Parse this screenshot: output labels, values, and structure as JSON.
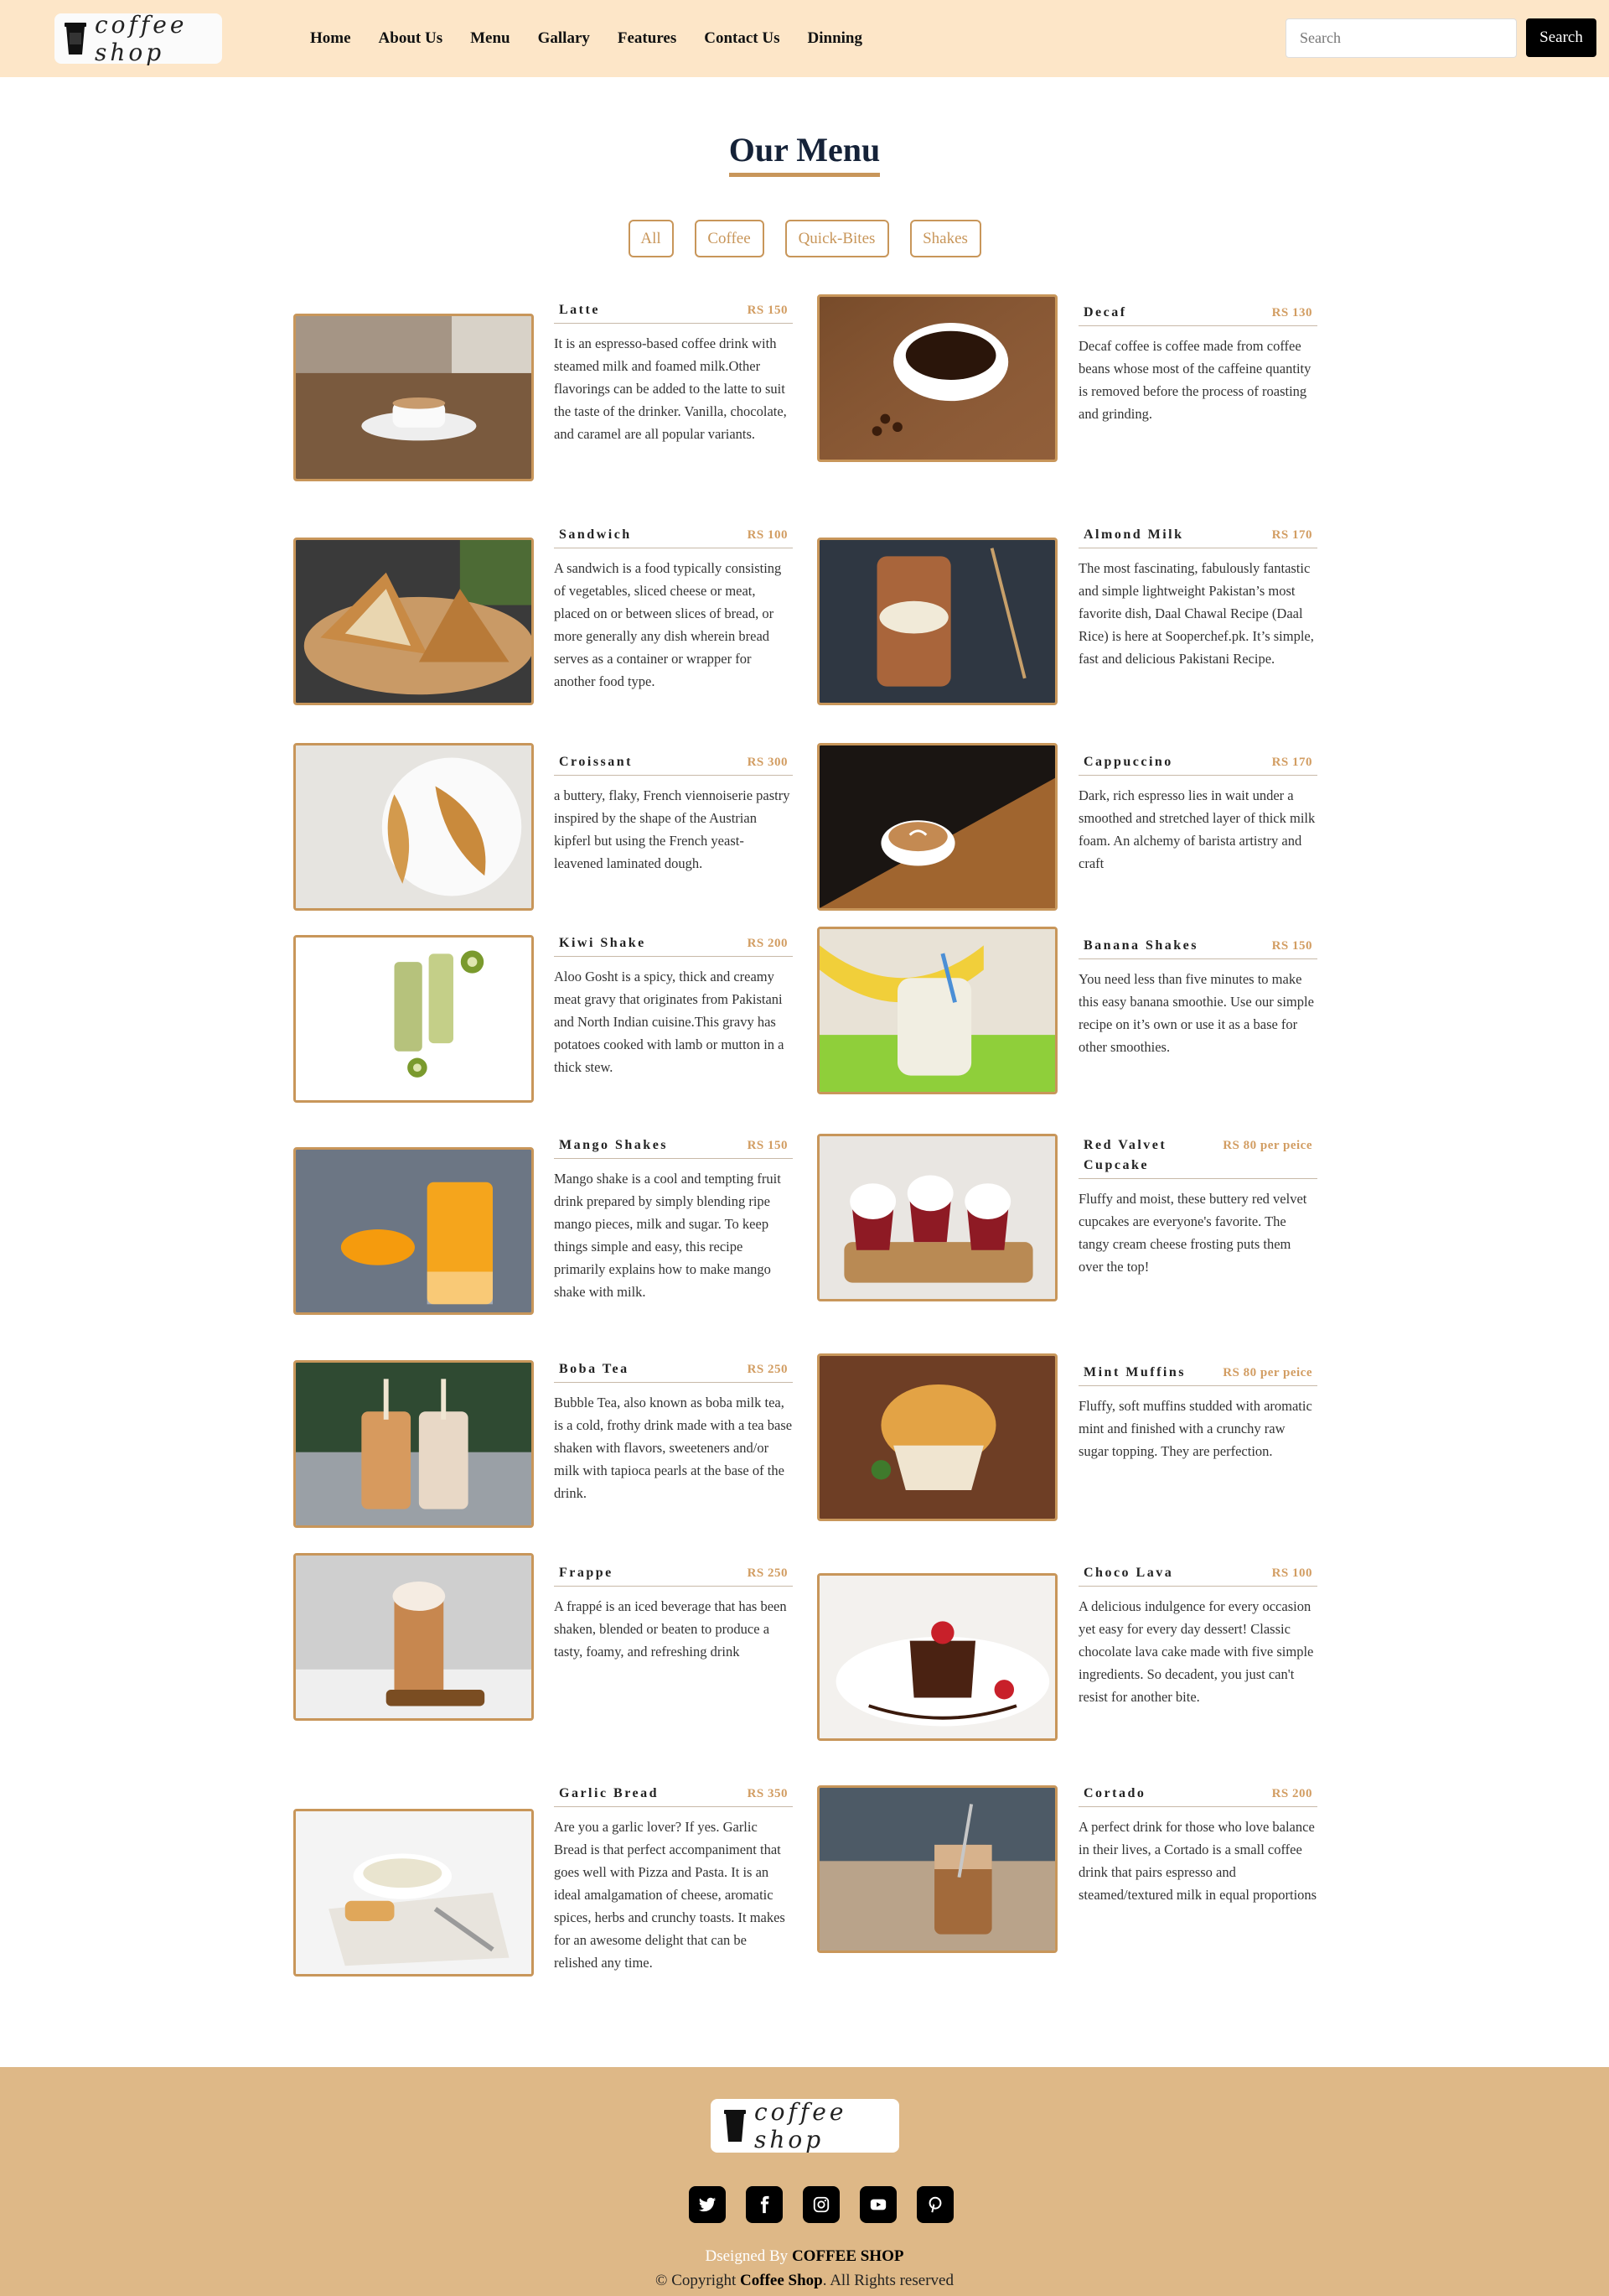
{
  "nav": {
    "logo_text": "coffee shop",
    "links": [
      "Home",
      "About Us",
      "Menu",
      "Gallary",
      "Features",
      "Contact Us",
      "Dinning"
    ],
    "search_placeholder": "Search",
    "search_button": "Search"
  },
  "menu": {
    "title": "Our Menu",
    "filters": [
      "All",
      "Coffee",
      "Quick-Bites",
      "Shakes"
    ],
    "items": [
      {
        "name": "Latte",
        "price": "RS 150",
        "desc": "It is an espresso-based coffee drink with steamed milk and foamed milk.Other flavorings can be added to the latte to suit the taste of the drinker. Vanilla, chocolate, and caramel are all popular variants.",
        "image": "latte-photo"
      },
      {
        "name": "Decaf",
        "price": "RS 130",
        "desc": "Decaf coffee is coffee made from coffee beans whose most of the caffeine quantity is removed before the process of roasting and grinding.",
        "image": "decaf-photo"
      },
      {
        "name": "Sandwich",
        "price": "RS 100",
        "desc": "A sandwich is a food typically consisting of vegetables, sliced cheese or meat, placed on or between slices of bread, or more generally any dish wherein bread serves as a container or wrapper for another food type.",
        "image": "sandwich-photo"
      },
      {
        "name": "Almond Milk",
        "price": "RS 170",
        "desc": "The most fascinating, fabulously fantastic and simple lightweight Pakistan’s most favorite dish, Daal Chawal Recipe (Daal Rice) is here at Sooperchef.pk. It’s simple, fast and delicious Pakistani Recipe.",
        "image": "almond-milk-photo"
      },
      {
        "name": "Croissant",
        "price": "RS 300",
        "desc": "a buttery, flaky, French viennoiserie pastry inspired by the shape of the Austrian kipferl but using the French yeast-leavened laminated dough.",
        "image": "croissant-photo"
      },
      {
        "name": "Cappuccino",
        "price": "RS 170",
        "desc": "Dark, rich espresso lies in wait under a smoothed and stretched layer of thick milk foam. An alchemy of barista artistry and craft",
        "image": "cappuccino-photo"
      },
      {
        "name": "Kiwi Shake",
        "price": "RS 200",
        "desc": "Aloo Gosht is a spicy, thick and creamy meat gravy that originates from Pakistani and North Indian cuisine.This gravy has potatoes cooked with lamb or mutton in a thick stew.",
        "image": "kiwi-shake-photo"
      },
      {
        "name": "Banana Shakes",
        "price": "RS 150",
        "desc": "You need less than five minutes to make this easy banana smoothie. Use our simple recipe on it’s own or use it as a base for other smoothies.",
        "image": "banana-shake-photo"
      },
      {
        "name": "Mango Shakes",
        "price": "RS 150",
        "desc": "Mango shake is a cool and tempting fruit drink prepared by simply blending ripe mango pieces, milk and sugar. To keep things simple and easy, this recipe primarily explains how to make mango shake with milk.",
        "image": "mango-shake-photo"
      },
      {
        "name": "Red Valvet Cupcake",
        "price": "RS 80 per peice",
        "desc": "Fluffy and moist, these buttery red velvet cupcakes are everyone's favorite. The tangy cream cheese frosting puts them over the top!",
        "image": "cupcake-photo"
      },
      {
        "name": "Boba Tea",
        "price": "RS 250",
        "desc": "Bubble Tea, also known as boba milk tea, is a cold, frothy drink made with a tea base shaken with flavors, sweeteners and/or milk with tapioca pearls at the base of the drink.",
        "image": "boba-tea-photo"
      },
      {
        "name": "Mint Muffins",
        "price": "RS 80 per peice",
        "desc": "Fluffy, soft muffins studded with aromatic mint and finished with a crunchy raw sugar topping. They are perfection.",
        "image": "muffin-photo"
      },
      {
        "name": "Frappe",
        "price": "RS 250",
        "desc": "A frappé is an iced beverage that has been shaken, blended or beaten to produce a tasty, foamy, and refreshing drink",
        "image": "frappe-photo"
      },
      {
        "name": "Choco Lava",
        "price": "RS 100",
        "desc": "A delicious indulgence for every occasion yet easy for every day dessert! Classic chocolate lava cake made with five simple ingredients. So decadent, you just can't resist for another bite.",
        "image": "choco-lava-photo"
      },
      {
        "name": "Garlic Bread",
        "price": "RS 350",
        "desc": "Are you a garlic lover? If yes. Garlic Bread is that perfect accompaniment that goes well with Pizza and Pasta. It is an ideal amalgamation of cheese, aromatic spices, herbs and crunchy toasts. It makes for an awesome delight that can be relished any time.",
        "image": "garlic-bread-photo"
      },
      {
        "name": "Cortado",
        "price": "RS 200",
        "desc": "A perfect drink for those who love balance in their lives, a Cortado is a small coffee drink that pairs espresso and steamed/textured milk in equal proportions",
        "image": "cortado-photo"
      }
    ]
  },
  "footer": {
    "logo_text": "coffee shop",
    "socials": [
      "twitter-icon",
      "facebook-icon",
      "instagram-icon",
      "youtube-icon",
      "pinterest-icon"
    ],
    "designed_prefix": "Dseigned By",
    "designed_brand": "COFFEE SHOP",
    "copyright_prefix": "© Copyright",
    "copyright_brand": "Coffee Shop",
    "copyright_suffix": ". All Rights reserved"
  },
  "colors": {
    "nav_bg": "#fde6c8",
    "accent": "#c8965a",
    "price": "#d29d62",
    "footer_bg": "#deb887",
    "title": "#152238"
  }
}
